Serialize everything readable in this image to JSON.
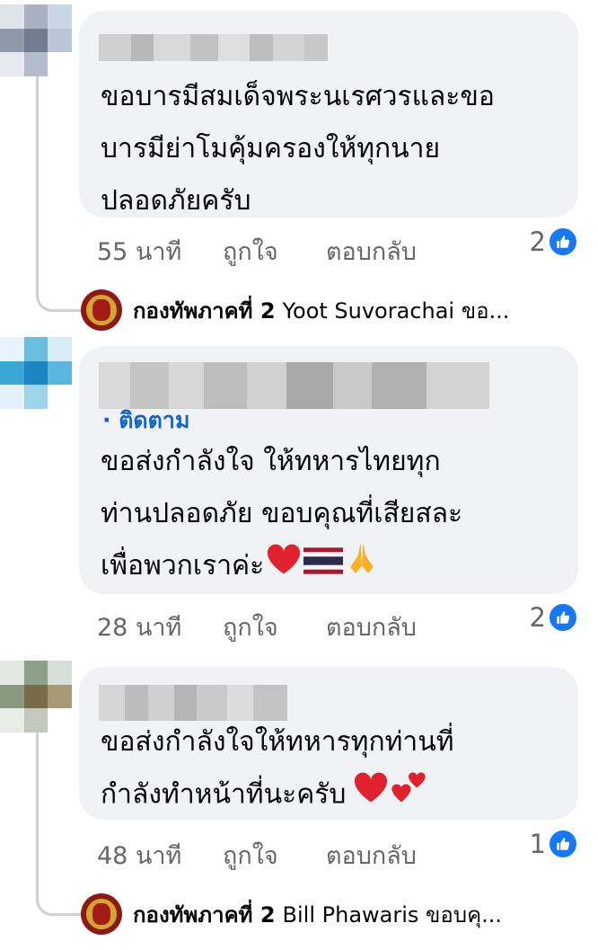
{
  "comments": [
    {
      "text": "ขอบารมีสมเด็จพระนเรศวรและขอ\nบารมีย่าโมคุ้มครองให้ทุกนาย\nปลอดภัยครับ",
      "time": "55 นาที",
      "like": "ถูกใจ",
      "reply": "ตอบกลับ",
      "reactions": "2"
    },
    {
      "follow": "· ติดตาม",
      "text": "ขอส่งกำลังใจ ให้ทหารไทยทุก\nท่านปลอดภัย ขอบคุณที่เสียสละ\nเพื่อพวกเราค่ะ",
      "time": "28 นาที",
      "like": "ถูกใจ",
      "reply": "ตอบกลับ",
      "reactions": "2"
    },
    {
      "text": "ขอส่งกำลังใจให้ทหารทุกท่านที่\nกำลังทำหน้าที่นะครับ",
      "time": "48 นาที",
      "like": "ถูกใจ",
      "reply": "ตอบกลับ",
      "reactions": "1"
    }
  ],
  "replies": [
    {
      "author": "กองทัพภาคที่ 2",
      "preview": "Yoot Suvorachai ขอ..."
    },
    {
      "author": "กองทัพภาคที่ 2",
      "preview": "Bill Phawaris ขอบคุ..."
    }
  ],
  "colors": {
    "link": "#1664c4",
    "like_icon": "#1877f2",
    "bubble": "#f0f2f5",
    "meta": "#65676b"
  },
  "icons": [
    "like-icon",
    "heart-emoji",
    "thai-flag-emoji",
    "folded-hands-emoji",
    "two-hearts-emoji",
    "army-emblem"
  ]
}
